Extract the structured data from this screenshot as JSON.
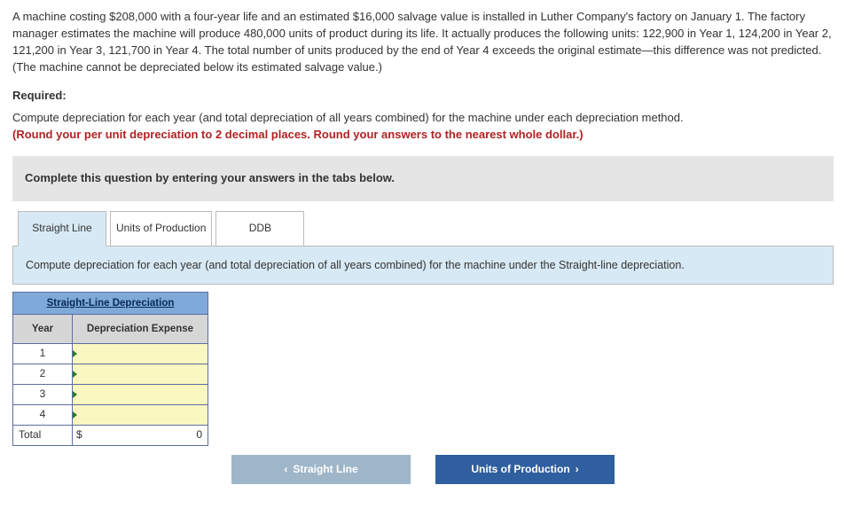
{
  "problem": {
    "text": "A machine costing $208,000 with a four-year life and an estimated $16,000 salvage value is installed in Luther Company's factory on January 1. The factory manager estimates the machine will produce 480,000 units of product during its life. It actually produces the following units: 122,900 in Year 1, 124,200 in Year 2, 121,200 in Year 3, 121,700 in Year 4. The total number of units produced by the end of Year 4 exceeds the original estimate—this difference was not predicted. (The machine cannot be depreciated below its estimated salvage value.)"
  },
  "required_label": "Required:",
  "required_text": "Compute depreciation for each year (and total depreciation of all years combined) for the machine under each depreciation method.",
  "round_note": "(Round your per unit depreciation to 2 decimal places. Round your answers to the nearest whole dollar.)",
  "panel_header": "Complete this question by entering your answers in the tabs below.",
  "tabs": {
    "straight": "Straight Line",
    "units": "Units of Production",
    "ddb": "DDB"
  },
  "tab_body_text": "Compute depreciation for each year (and total depreciation of all years combined) for the machine under the Straight-line depreciation.",
  "sl_table": {
    "title": "Straight-Line Depreciation",
    "col_year": "Year",
    "col_exp": "Depreciation Expense",
    "rows": [
      "1",
      "2",
      "3",
      "4"
    ],
    "total_label": "Total",
    "total_currency": "$",
    "total_value": "0"
  },
  "nav": {
    "prev_label": "Straight Line",
    "next_label": "Units of Production"
  }
}
